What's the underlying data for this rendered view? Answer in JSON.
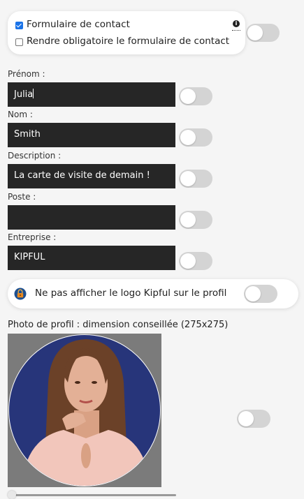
{
  "contact_card": {
    "form_label": "Formulaire de contact",
    "form_checked": true,
    "mandatory_label": "Rendre obligatoire le formulaire de contact",
    "mandatory_checked": false,
    "info_icon": "info-circle"
  },
  "fields": [
    {
      "label": "Prénom :",
      "value": "Julia"
    },
    {
      "label": "Nom :",
      "value": "Smith"
    },
    {
      "label": "Description :",
      "value": "La carte de visite de demain !"
    },
    {
      "label": "Poste :",
      "value": ""
    },
    {
      "label": "Entreprise :",
      "value": "KIPFUL"
    }
  ],
  "logo_card": {
    "label": "Ne pas afficher le logo Kipful sur le profil",
    "icon": "lock-icon"
  },
  "photo": {
    "label": "Photo de profil : dimension conseillée (275x275)"
  },
  "colors": {
    "field_bg": "#262626",
    "toggle_off": "#d4d4d4",
    "photo_bg": "#7b7b7b",
    "avatar_bg": "#27357a",
    "lock_orange": "#e8891f",
    "lock_blue": "#1d4f8f"
  }
}
